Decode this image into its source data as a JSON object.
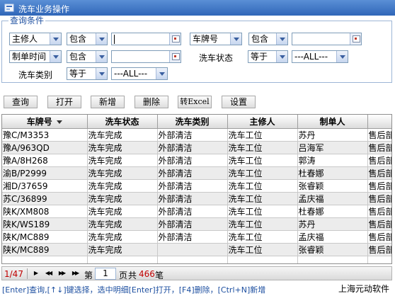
{
  "window": {
    "title": "洗车业务操作"
  },
  "query": {
    "legend": "查询条件",
    "row1": {
      "field1": "主修人",
      "op1": "包含",
      "value1": "",
      "field2": "车牌号",
      "op2": "包含",
      "value2": ""
    },
    "row2": {
      "field1": "制单时间",
      "op1": "包含",
      "value1": "",
      "status_label": "洗车状态",
      "status_op": "等于",
      "status_value": "---ALL---"
    },
    "row3": {
      "type_label": "洗车类别",
      "type_op": "等于",
      "type_value": "---ALL---"
    }
  },
  "toolbar": {
    "query": "查询",
    "open": "打开",
    "add": "新增",
    "delete": "删除",
    "export": "转Excel",
    "settings": "设置"
  },
  "table": {
    "columns": [
      "车牌号",
      "洗车状态",
      "洗车类别",
      "主修人",
      "制单人",
      ""
    ],
    "rows": [
      [
        "豫C/M3353",
        "洗车完成",
        "外部清洁",
        "洗车工位",
        "苏丹",
        "售后部"
      ],
      [
        "豫A/963QD",
        "洗车完成",
        "外部清洁",
        "洗车工位",
        "吕海军",
        "售后部"
      ],
      [
        "豫A/8H268",
        "洗车完成",
        "外部清洁",
        "洗车工位",
        "郭涛",
        "售后部"
      ],
      [
        "渝B/P2999",
        "洗车完成",
        "外部清洁",
        "洗车工位",
        "杜春娜",
        "售后部"
      ],
      [
        "湘D/37659",
        "洗车完成",
        "外部清洁",
        "洗车工位",
        "张睿颖",
        "售后部"
      ],
      [
        "苏C/36899",
        "洗车完成",
        "外部清洁",
        "洗车工位",
        "孟庆福",
        "售后部"
      ],
      [
        "陕K/XM808",
        "洗车完成",
        "外部清洁",
        "洗车工位",
        "杜春娜",
        "售后部"
      ],
      [
        "陕K/WS189",
        "洗车完成",
        "外部清洁",
        "洗车工位",
        "苏丹",
        "售后部"
      ],
      [
        "陕K/MC889",
        "洗车完成",
        "外部清洁",
        "洗车工位",
        "孟庆福",
        "售后部"
      ],
      [
        "陕K/MC889",
        "洗车完成",
        "",
        "洗车工位",
        "张睿颖",
        "售后部"
      ]
    ]
  },
  "pager": {
    "page_count": "1/47",
    "first_icon": "first-page-icon",
    "prev_icon": "prev-page-icon",
    "next_icon": "next-page-icon",
    "last_icon": "last-page-icon",
    "label_di": "第",
    "page": "1",
    "label_ye": "页",
    "label_gong": "共",
    "total": "466",
    "label_bi": "笔"
  },
  "footer": {
    "hint": "[Enter]查询,[↑↓]键选择，选中明细[Enter]打开，[F4]删除，[Ctrl+N]新增",
    "brand": "上海元动软件"
  },
  "colors": {
    "title_bar": "#2f66b8",
    "accent_text": "#1d4fa0",
    "pager_red": "#c00000"
  }
}
